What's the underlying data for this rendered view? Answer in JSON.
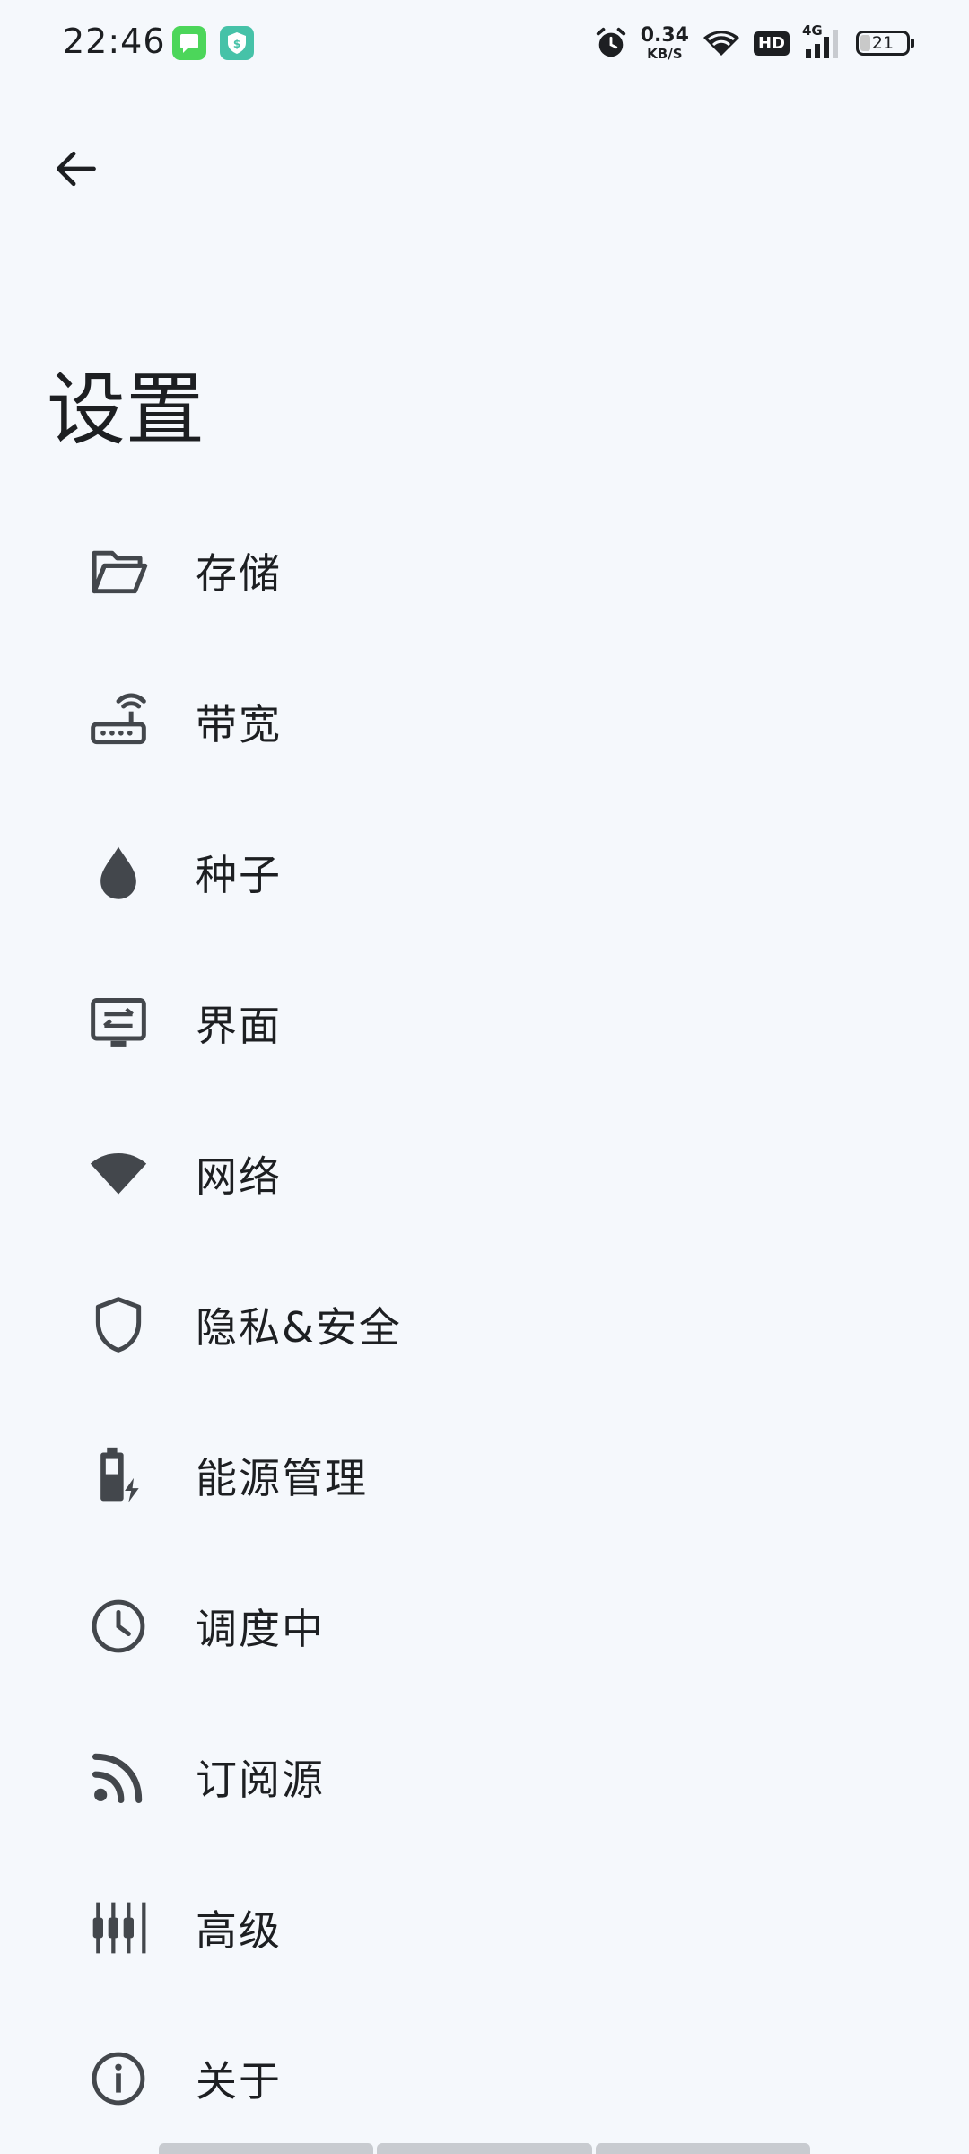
{
  "status_bar": {
    "time": "22:46",
    "net_speed_value": "0.34",
    "net_speed_unit": "KB/S",
    "hd": "HD",
    "signal_label": "4G",
    "battery": "21",
    "battery_level_percent": 21,
    "icons": [
      "message-app-icon",
      "shield-app-icon",
      "alarm-icon",
      "wifi-icon",
      "hd-icon",
      "cellular-signal-icon",
      "battery-icon"
    ]
  },
  "header": {
    "back_icon": "arrow-left-icon",
    "title": "设置"
  },
  "settings": {
    "items": [
      {
        "id": "storage",
        "label": "存储",
        "icon": "folder-open-icon"
      },
      {
        "id": "bandwidth",
        "label": "带宽",
        "icon": "router-icon"
      },
      {
        "id": "torrent",
        "label": "种子",
        "icon": "water-drop-icon"
      },
      {
        "id": "interface",
        "label": "界面",
        "icon": "monitor-settings-icon"
      },
      {
        "id": "network",
        "label": "网络",
        "icon": "wifi-icon"
      },
      {
        "id": "privacy",
        "label": "隐私&安全",
        "icon": "shield-icon"
      },
      {
        "id": "power",
        "label": "能源管理",
        "icon": "battery-charging-icon"
      },
      {
        "id": "scheduling",
        "label": "调度中",
        "icon": "clock-icon"
      },
      {
        "id": "feeds",
        "label": "订阅源",
        "icon": "rss-icon"
      },
      {
        "id": "advanced",
        "label": "高级",
        "icon": "tune-icon"
      },
      {
        "id": "about",
        "label": "关于",
        "icon": "info-icon"
      }
    ]
  },
  "colors": {
    "background": "#f5f8fc",
    "icon": "#43474c",
    "text": "#1d1f22"
  }
}
